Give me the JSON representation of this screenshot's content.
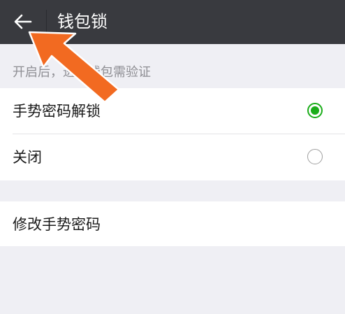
{
  "header": {
    "back_icon": "arrow-left-icon",
    "title": "钱包锁"
  },
  "hint": "开启后，进入钱包需验证",
  "options": [
    {
      "label": "手势密码解锁",
      "selected": true
    },
    {
      "label": "关闭",
      "selected": false
    }
  ],
  "actions": [
    {
      "label": "修改手势密码"
    }
  ],
  "colors": {
    "topbar": "#393a3f",
    "accent_green": "#1aad19",
    "annotation_arrow": "#f26a21",
    "background": "#efeff4"
  }
}
